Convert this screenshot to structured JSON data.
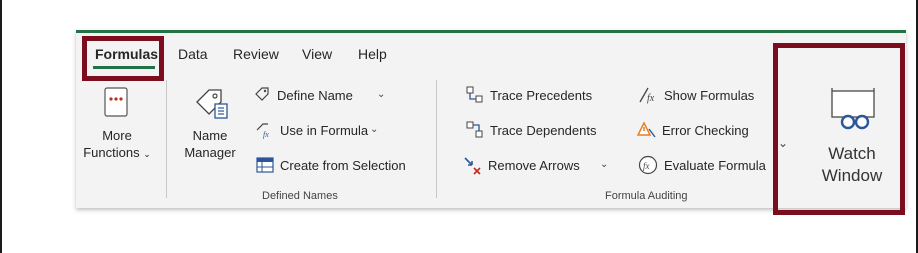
{
  "tabs": [
    {
      "label": "Formulas",
      "active": true
    },
    {
      "label": "Data"
    },
    {
      "label": "Review"
    },
    {
      "label": "View"
    },
    {
      "label": "Help"
    }
  ],
  "more_functions": {
    "line1": "More",
    "line2": "Functions"
  },
  "defined_names": {
    "name_manager": {
      "line1": "Name",
      "line2": "Manager"
    },
    "define_name": "Define Name",
    "use_in_formula": "Use in Formula",
    "create_from_selection": "Create from Selection",
    "group_label": "Defined Names"
  },
  "formula_auditing": {
    "trace_precedents": "Trace Precedents",
    "trace_dependents": "Trace Dependents",
    "remove_arrows": "Remove Arrows",
    "show_formulas": "Show Formulas",
    "error_checking": "Error Checking",
    "evaluate_formula": "Evaluate Formula",
    "group_label": "Formula Auditing"
  },
  "watch_window": {
    "line1": "Watch",
    "line2": "Window"
  },
  "colors": {
    "highlight": "#7b0d1e",
    "accent": "#217346",
    "icon_blue": "#2b579a",
    "icon_red": "#c42b1c",
    "icon_orange": "#e67e22"
  },
  "icons": [
    "more-functions-icon",
    "name-manager-icon",
    "tag-icon",
    "fx-icon",
    "table-icon",
    "trace-precedents-icon",
    "trace-dependents-icon",
    "remove-arrows-icon",
    "show-formulas-icon",
    "error-checking-icon",
    "evaluate-formula-icon",
    "watch-window-icon"
  ]
}
